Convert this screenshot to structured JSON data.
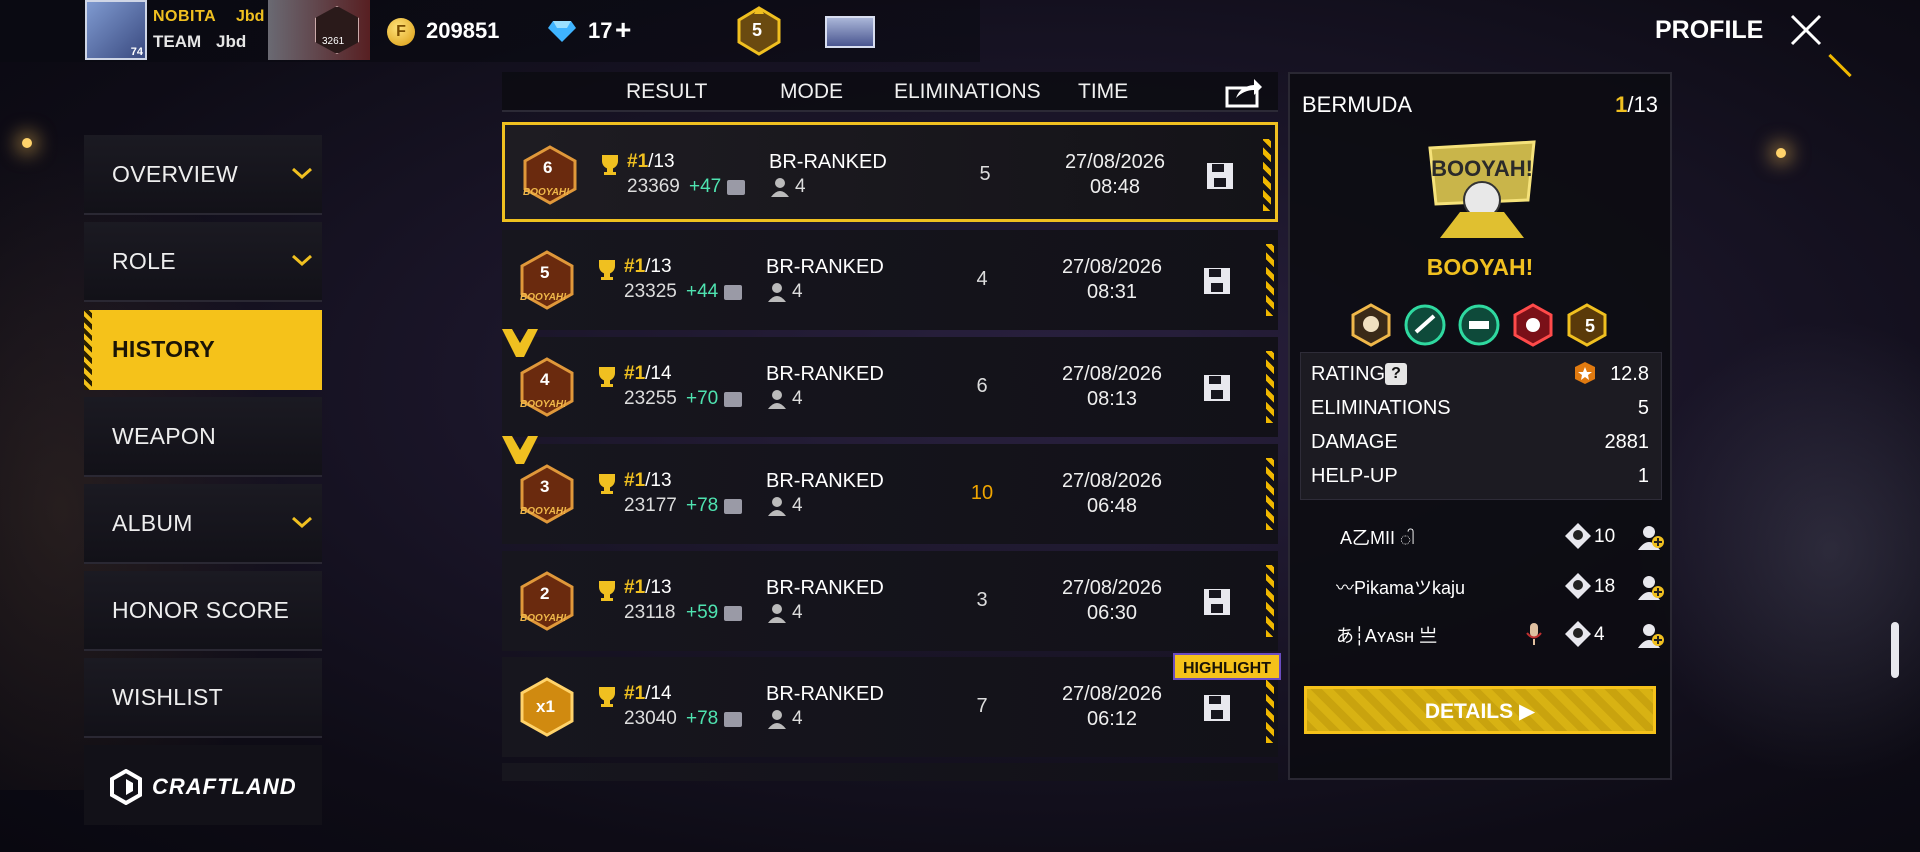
{
  "header": {
    "player_name": "NOBITA",
    "player_tag": "Jbd",
    "avatar_level": "74",
    "team_label": "TEAM",
    "team_name": "Jbd",
    "banner_number": "3261",
    "coins": "209851",
    "diamonds": "17",
    "diamonds_plus": "+",
    "rank_level": "5",
    "profile_label": "PROFILE"
  },
  "sidebar": {
    "items": [
      {
        "label": "OVERVIEW",
        "chevron": true
      },
      {
        "label": "ROLE",
        "chevron": true
      },
      {
        "label": "HISTORY",
        "active": true
      },
      {
        "label": "WEAPON"
      },
      {
        "label": "ALBUM",
        "chevron": true
      },
      {
        "label": "HONOR SCORE"
      },
      {
        "label": "WISHLIST"
      }
    ],
    "craftland_label": "CRAFTLAND"
  },
  "table": {
    "headers": {
      "result": "RESULT",
      "mode": "MODE",
      "eliminations": "ELIMINATIONS",
      "time": "TIME"
    },
    "rows": [
      {
        "badge": "6",
        "badge_word": "BOOYAH!",
        "rank_pos": "#1",
        "rank_total": "/13",
        "score": "23369",
        "delta": "+47",
        "mode": "BR-RANKED",
        "squad": "4",
        "elims": "5",
        "date": "27/08/2026",
        "time": "08:48"
      },
      {
        "badge": "5",
        "badge_word": "BOOYAH!",
        "rank_pos": "#1",
        "rank_total": "/13",
        "score": "23325",
        "delta": "+44",
        "mode": "BR-RANKED",
        "squad": "4",
        "elims": "4",
        "date": "27/08/2026",
        "time": "08:31"
      },
      {
        "badge": "4",
        "badge_word": "BOOYAH!",
        "rank_pos": "#1",
        "rank_total": "/14",
        "score": "23255",
        "delta": "+70",
        "mode": "BR-RANKED",
        "squad": "4",
        "elims": "6",
        "date": "27/08/2026",
        "time": "08:13"
      },
      {
        "badge": "3",
        "badge_word": "BOOYAH!",
        "rank_pos": "#1",
        "rank_total": "/13",
        "score": "23177",
        "delta": "+78",
        "mode": "BR-RANKED",
        "squad": "4",
        "elims": "10",
        "date": "27/08/2026",
        "time": "06:48"
      },
      {
        "badge": "2",
        "badge_word": "BOOYAH!",
        "rank_pos": "#1",
        "rank_total": "/13",
        "score": "23118",
        "delta": "+59",
        "mode": "BR-RANKED",
        "squad": "4",
        "elims": "3",
        "date": "27/08/2026",
        "time": "06:30"
      },
      {
        "badge": "x1",
        "badge_word": "",
        "rank_pos": "#1",
        "rank_total": "/14",
        "score": "23040",
        "delta": "+78",
        "mode": "BR-RANKED",
        "squad": "4",
        "elims": "7",
        "date": "27/08/2026",
        "time": "06:12"
      }
    ],
    "highlight_tag": "HIGHLIGHT"
  },
  "panel": {
    "map": "BERMUDA",
    "rank_current": "1",
    "rank_total": "/13",
    "booyah_art_text": "BOOYAH!",
    "booyah_title": "BOOYAH!",
    "medal_five": "5",
    "stats": [
      {
        "label": "RATING",
        "value": "12.8"
      },
      {
        "label": "ELIMINATIONS",
        "value": "5"
      },
      {
        "label": "DAMAGE",
        "value": "2881"
      },
      {
        "label": "HELP-UP",
        "value": "1"
      }
    ],
    "help_glyph": "?",
    "teammates": [
      {
        "name": "A乙MII ါ",
        "elims": "10"
      },
      {
        "name": "〰Pikamaツkaju",
        "elims": "18"
      },
      {
        "name": "あ┆Aʏᴀsʜ 亗",
        "elims": "4"
      }
    ],
    "details_label": "DETAILS"
  }
}
